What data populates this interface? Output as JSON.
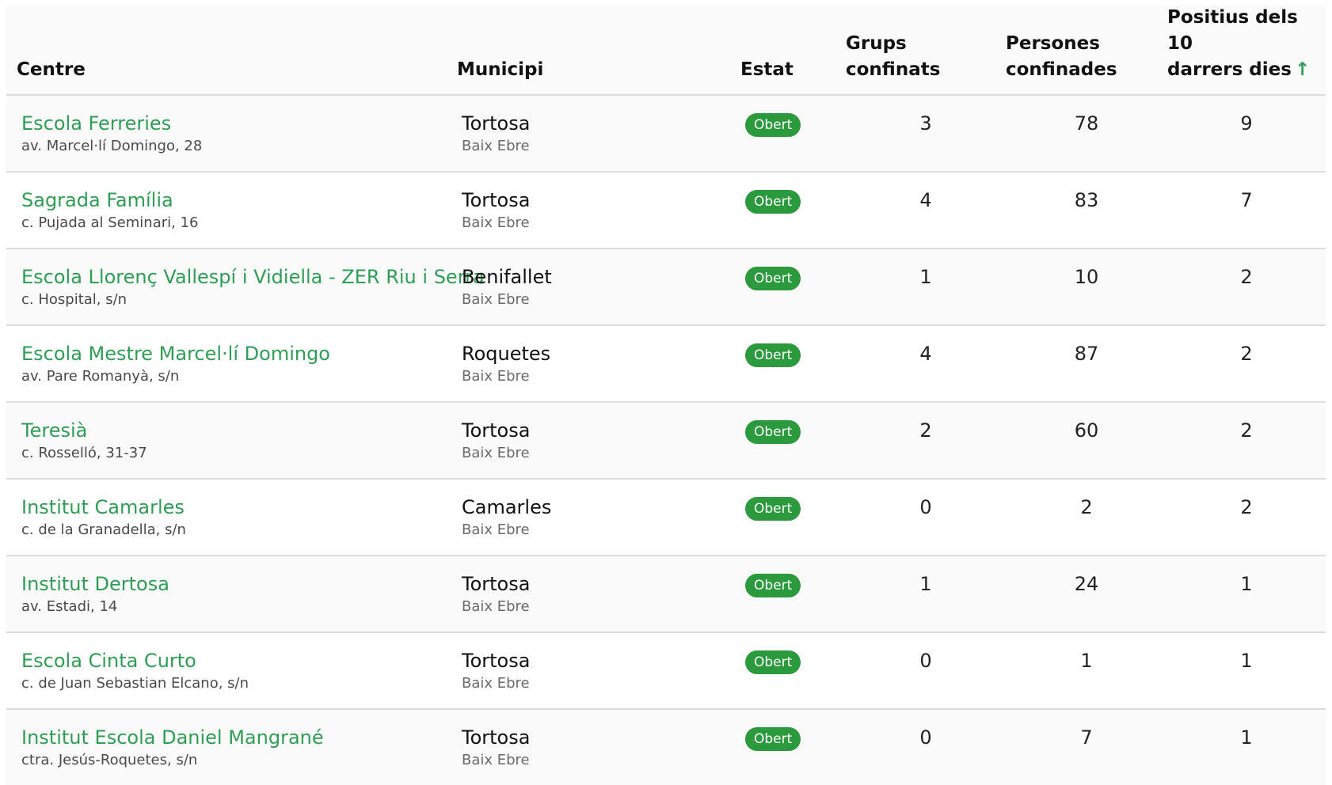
{
  "colors": {
    "accent_green": "#2e9e54",
    "badge_green": "#2a9a3c",
    "row_alt": "#fafafa",
    "divider": "#dcdcdc"
  },
  "headers": {
    "centre": "Centre",
    "municipi": "Municipi",
    "estat": "Estat",
    "grups": "Grups confinats",
    "persones_line1": "Persones",
    "persones_line2": "confinades",
    "positius_line1": "Positius dels 10",
    "positius_line2": "darrers dies",
    "sort_icon": "arrow-up-icon",
    "sort_glyph": "↑"
  },
  "rows": [
    {
      "name": "Escola Ferreries",
      "address": "av. Marcel·lí Domingo, 28",
      "municipi": "Tortosa",
      "comarca": "Baix Ebre",
      "estat": "Obert",
      "grups": "3",
      "persones": "78",
      "positius": "9"
    },
    {
      "name": "Sagrada Família",
      "address": "c. Pujada al Seminari, 16",
      "municipi": "Tortosa",
      "comarca": "Baix Ebre",
      "estat": "Obert",
      "grups": "4",
      "persones": "83",
      "positius": "7"
    },
    {
      "name": "Escola Llorenç Vallespí i Vidiella - ZER Riu i Serra",
      "address": "c. Hospital, s/n",
      "municipi": "Benifallet",
      "comarca": "Baix Ebre",
      "estat": "Obert",
      "grups": "1",
      "persones": "10",
      "positius": "2"
    },
    {
      "name": "Escola Mestre Marcel·lí Domingo",
      "address": "av. Pare Romanyà, s/n",
      "municipi": "Roquetes",
      "comarca": "Baix Ebre",
      "estat": "Obert",
      "grups": "4",
      "persones": "87",
      "positius": "2"
    },
    {
      "name": "Teresià",
      "address": "c. Rosselló, 31-37",
      "municipi": "Tortosa",
      "comarca": "Baix Ebre",
      "estat": "Obert",
      "grups": "2",
      "persones": "60",
      "positius": "2"
    },
    {
      "name": "Institut Camarles",
      "address": "c. de la Granadella, s/n",
      "municipi": "Camarles",
      "comarca": "Baix Ebre",
      "estat": "Obert",
      "grups": "0",
      "persones": "2",
      "positius": "2"
    },
    {
      "name": "Institut Dertosa",
      "address": "av. Estadi, 14",
      "municipi": "Tortosa",
      "comarca": "Baix Ebre",
      "estat": "Obert",
      "grups": "1",
      "persones": "24",
      "positius": "1"
    },
    {
      "name": "Escola Cinta Curto",
      "address": "c. de Juan Sebastian Elcano, s/n",
      "municipi": "Tortosa",
      "comarca": "Baix Ebre",
      "estat": "Obert",
      "grups": "0",
      "persones": "1",
      "positius": "1"
    },
    {
      "name": "Institut Escola Daniel Mangrané",
      "address": "ctra. Jesús-Roquetes, s/n",
      "municipi": "Tortosa",
      "comarca": "Baix Ebre",
      "estat": "Obert",
      "grups": "0",
      "persones": "7",
      "positius": "1"
    }
  ]
}
